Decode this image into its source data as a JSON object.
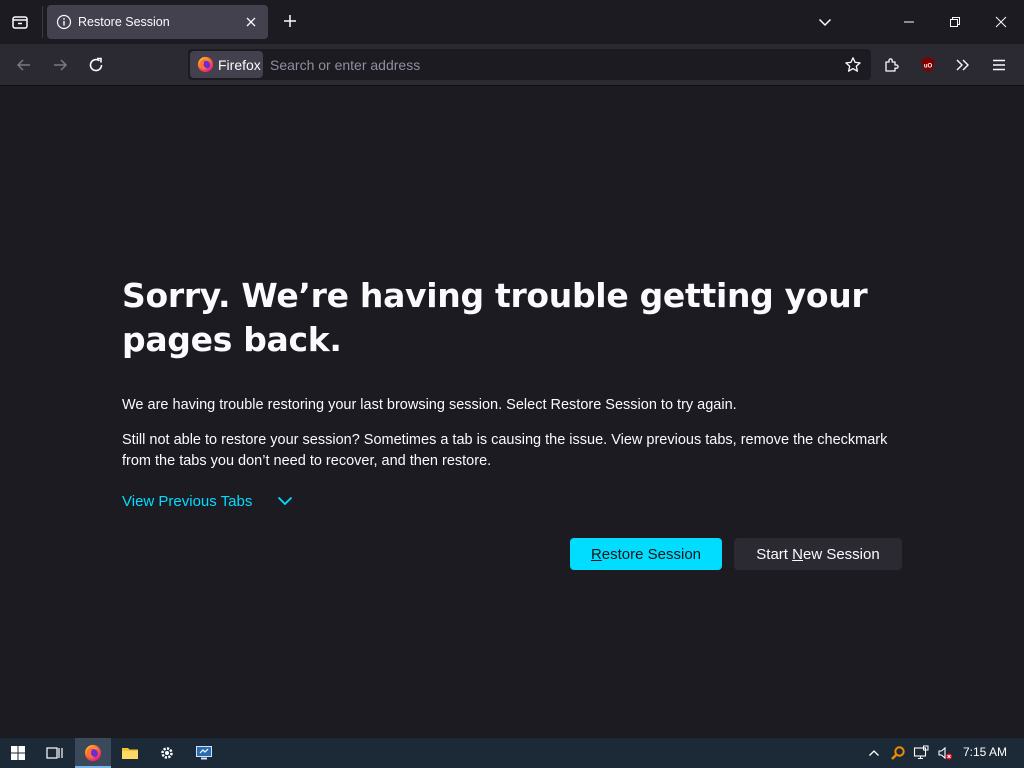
{
  "tab": {
    "title": "Restore Session"
  },
  "urlbar": {
    "identity_label": "Firefox",
    "placeholder": "Search or enter address"
  },
  "page": {
    "heading": "Sorry. We’re having trouble getting your pages back.",
    "paragraph1": "We are having trouble restoring your last browsing session. Select Restore Session to try again.",
    "paragraph2": "Still not able to restore your session? Sometimes a tab is causing the issue. View previous tabs, remove the checkmark from the tabs you don’t need to recover, and then restore.",
    "view_previous_tabs": "View Previous Tabs",
    "restore_button": {
      "accesskey": "R",
      "rest": "estore Session"
    },
    "new_session_button": {
      "before": "Start ",
      "accesskey": "N",
      "after": "ew Session"
    }
  },
  "taskbar": {
    "time": "7:15 AM"
  },
  "colors": {
    "accent": "#00ddff",
    "background": "#1c1b22",
    "toolbar": "#2b2a33",
    "tab_selected": "#42414d",
    "taskbar": "#1c2a38"
  },
  "icons": [
    "tab-list-icon",
    "info-icon",
    "close-icon",
    "plus-icon",
    "chevron-down-icon",
    "minimize-icon",
    "restore-icon",
    "back-icon",
    "forward-icon",
    "reload-icon",
    "firefox-logo",
    "star-icon",
    "extensions-icon",
    "ublock-icon",
    "overflow-icon",
    "menu-icon",
    "windows-start-icon",
    "task-view-icon",
    "file-explorer-icon",
    "settings-icon",
    "remote-desktop-icon",
    "tray-up-icon",
    "search-tray-icon",
    "network-icon",
    "volume-muted-icon"
  ]
}
